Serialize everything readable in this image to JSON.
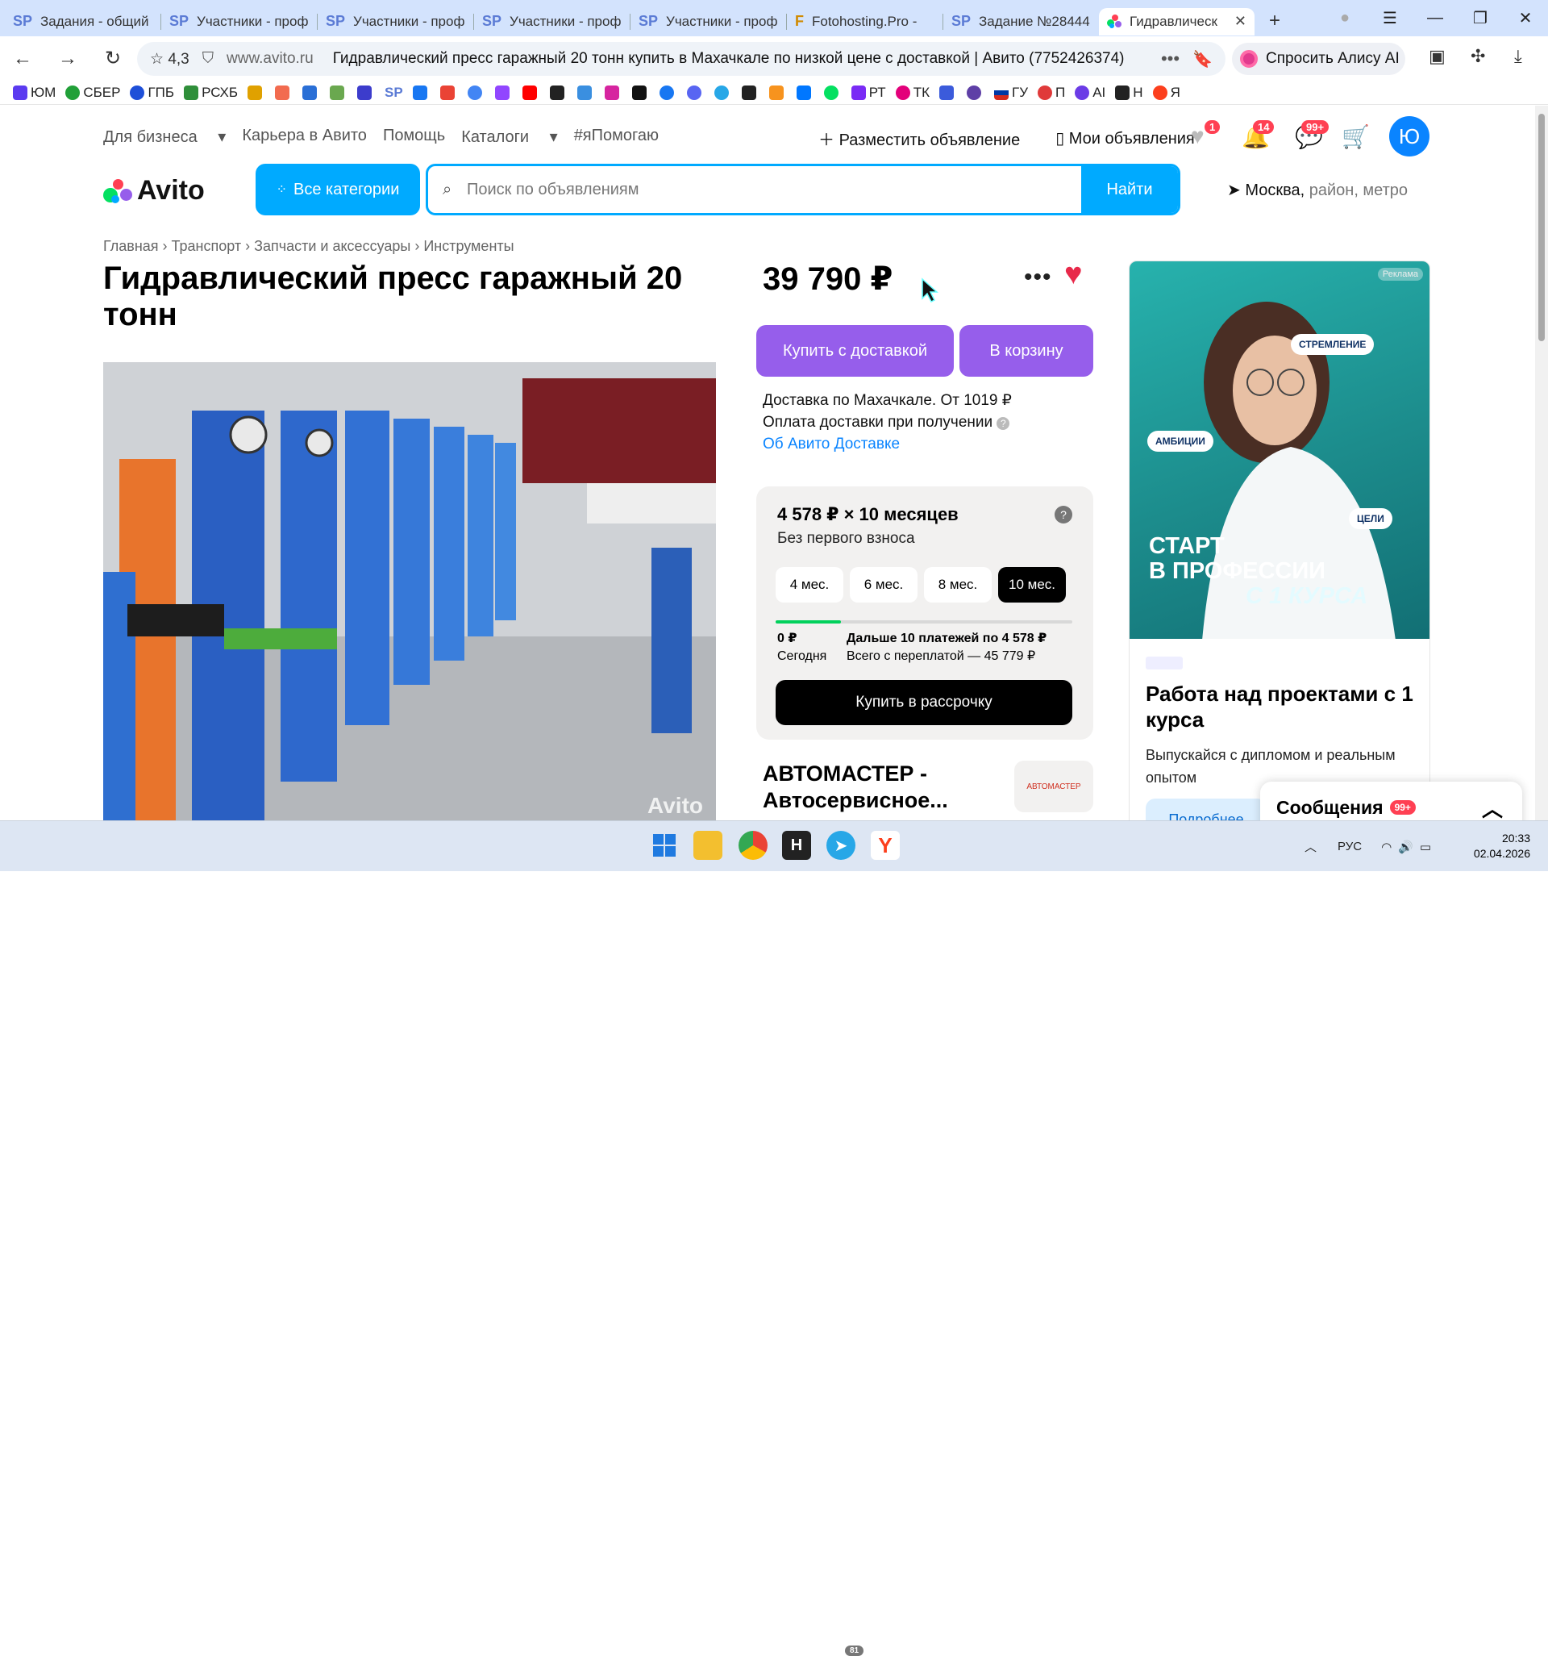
{
  "browser": {
    "tabs": [
      {
        "icon": "SP",
        "label": "Задания - общий"
      },
      {
        "icon": "SP",
        "label": "Участники - проф"
      },
      {
        "icon": "SP",
        "label": "Участники - проф"
      },
      {
        "icon": "SP",
        "label": "Участники - проф"
      },
      {
        "icon": "SP",
        "label": "Участники - проф"
      },
      {
        "icon": "F",
        "label": "Fotohosting.Pro -"
      },
      {
        "icon": "SP",
        "label": "Задание №28444"
      },
      {
        "icon": "avito",
        "label": "Гидравлическ"
      }
    ],
    "rating": "4,3",
    "host": "www.avito.ru",
    "page_title": "Гидравлический пресс гаражный 20 тонн купить в Махачкале по низкой цене с доставкой | Авито (7752426374)",
    "alice_label": "Спросить Алису AI",
    "bookmarks": [
      "ЮМ",
      "СБЕР",
      "ГПБ",
      "РСХБ",
      "",
      "",
      "",
      "",
      "",
      "SP",
      "",
      "",
      "",
      "",
      "",
      "",
      "",
      "",
      "",
      "",
      "",
      "",
      "",
      "",
      "",
      "",
      "",
      "",
      "РТ",
      "ТК",
      "",
      "",
      "ГУ",
      "П",
      "AI",
      "Н",
      "Я"
    ]
  },
  "avito": {
    "nav": [
      "Для бизнеса",
      "Карьера в Авито",
      "Помощь",
      "Каталоги",
      "#яПомогаю"
    ],
    "post_ad": "Разместить объявление",
    "my_ads": "Мои объявления",
    "badges": {
      "favorites": "1",
      "notifications": "14",
      "messages": "99+"
    },
    "avatar": "Ю",
    "logo": "Avito",
    "all_categories": "Все категории",
    "search_placeholder": "Поиск по объявлениям",
    "search_button": "Найти",
    "location_city": "Москва,",
    "location_sub": "район, метро",
    "breadcrumbs": [
      "Главная",
      "Транспорт",
      "Запчасти и аксессуары",
      "Инструменты"
    ],
    "title": "Гидравлический пресс гаражный 20 тонн",
    "price": "39 790 ₽",
    "buy_delivery": "Купить с доставкой",
    "to_cart": "В корзину",
    "delivery_line": "Доставка по Махачкале. От 1019 ₽",
    "payment_line": "Оплата доставки при получении",
    "delivery_link": "Об Авито Доставке",
    "installment": {
      "headline": "4 578 ₽ × 10 месяцев",
      "sub": "Без первого взноса",
      "months": [
        "4 мес.",
        "6 мес.",
        "8 мес.",
        "10 мес."
      ],
      "selected": "10 мес.",
      "progress": 0.22,
      "today_amount": "0 ₽",
      "today_label": "Сегодня",
      "next_payments": "Дальше 10 платежей по 4 578 ₽",
      "total": "Всего с переплатой — 45 779 ₽",
      "button": "Купить в рассрочку"
    },
    "seller_name": "АВТОМАСТЕР - Автосервисное...",
    "seller_logo_text": "АВТОМАСТЕР",
    "photo_watermark": "Avito",
    "ad": {
      "tag": "Реклама",
      "chips": [
        "СТРЕМЛЕНИЕ",
        "АМБИЦИИ",
        "ЦЕЛИ"
      ],
      "big_line1": "СТАРТ",
      "big_line2": "В ПРОФЕССИИ",
      "big_line3": "С 1 КУРСА",
      "heading": "Работа над проектами с 1 курса",
      "text": "Выпускайся с дипломом и реальным опытом",
      "button": "Подробнее"
    },
    "messages_label": "Сообщения",
    "messages_badge": "99+"
  },
  "taskbar": {
    "lang": "РУС",
    "time": "20:33",
    "date": "02.04.2026",
    "telegram_badge": "81"
  },
  "colors": {
    "avito_blue": "#00aaff",
    "purple_btn": "#965eeb",
    "heart": "#e8294a"
  }
}
